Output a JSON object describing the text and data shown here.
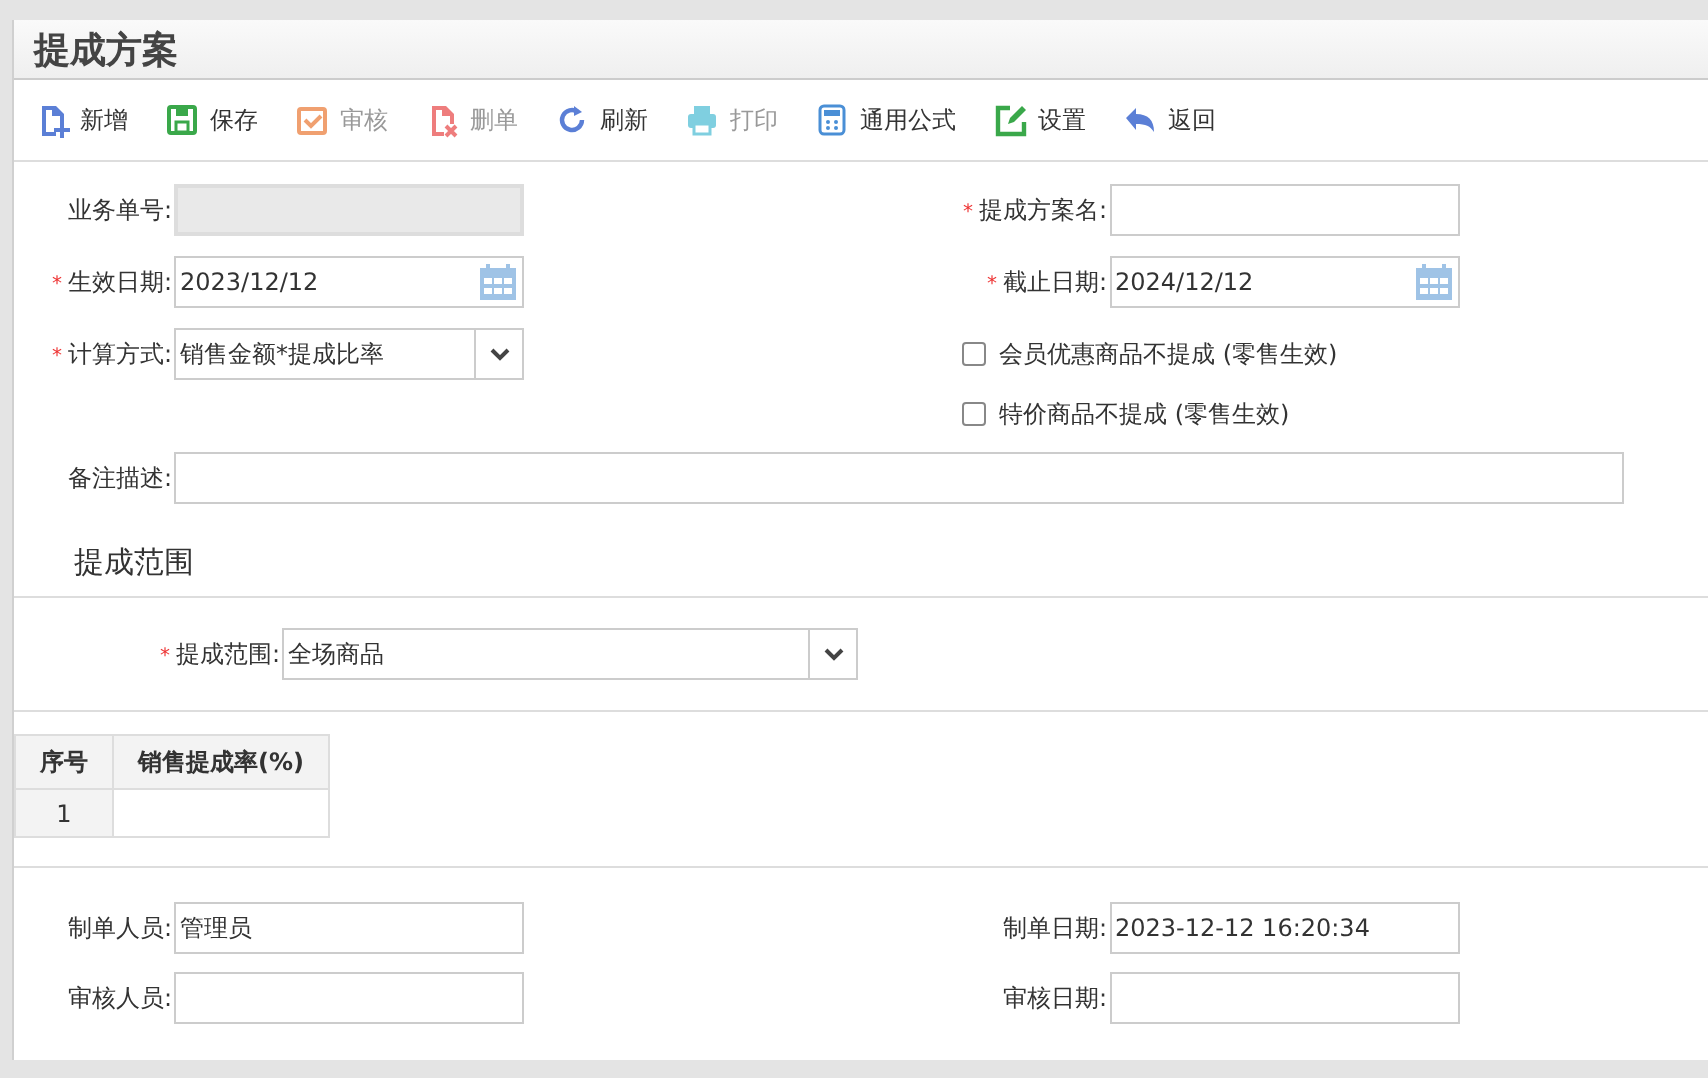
{
  "title": "提成方案",
  "toolbar": [
    {
      "label": "新增",
      "kind": "add",
      "disabled": false
    },
    {
      "label": "保存",
      "kind": "save",
      "disabled": false
    },
    {
      "label": "审核",
      "kind": "check",
      "disabled": true
    },
    {
      "label": "删单",
      "kind": "delete",
      "disabled": true
    },
    {
      "label": "刷新",
      "kind": "refresh",
      "disabled": false
    },
    {
      "label": "打印",
      "kind": "print",
      "disabled": true
    },
    {
      "label": "通用公式",
      "kind": "formula",
      "disabled": false
    },
    {
      "label": "设置",
      "kind": "edit",
      "disabled": false
    },
    {
      "label": "返回",
      "kind": "back",
      "disabled": false
    }
  ],
  "form_rows": [
    {
      "left": {
        "kind": "readonly",
        "label": "业务单号:"
      },
      "right": {
        "kind": "text",
        "required_mark": "*",
        "label": "提成方案名:"
      }
    },
    {
      "left": {
        "kind": "date",
        "required_mark": "*",
        "label": "生效日期:",
        "value": "2023/12/12"
      },
      "right": {
        "kind": "date",
        "required_mark": "*",
        "label": "截止日期:",
        "value": "2024/12/12"
      }
    },
    {
      "left": {
        "kind": "select",
        "required_mark": "*",
        "label": "计算方式:",
        "value": "销售金额*提成比率"
      },
      "right": {
        "kind": "checkbox",
        "label": "会员优惠商品不提成 (零售生效)",
        "checked": false
      }
    },
    {
      "right": {
        "kind": "checkbox",
        "label": "特价商品不提成 (零售生效)",
        "checked": false
      }
    }
  ],
  "remarks": {
    "label": "备注描述:"
  },
  "scope_section": {
    "heading": "提成范围",
    "required_mark": "*",
    "label": "提成范围:",
    "value": "全场商品"
  },
  "table": {
    "columns": [
      "序号",
      "销售提成率(%)"
    ],
    "rows": [
      {
        "index": "1"
      }
    ]
  },
  "footer_rows": [
    {
      "left": {
        "label": "制单人员:",
        "value": "管理员"
      },
      "right": {
        "label": "制单日期:",
        "value": "2023-12-12 16:20:34"
      }
    },
    {
      "left": {
        "label": "审核人员:"
      },
      "right": {
        "label": "审核日期:"
      }
    }
  ]
}
